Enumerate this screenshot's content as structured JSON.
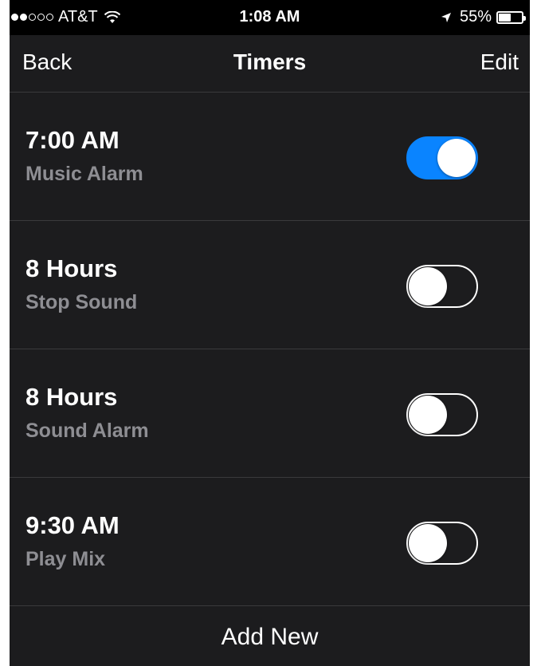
{
  "status_bar": {
    "carrier": "AT&T",
    "signal_bars_filled": 2,
    "signal_bars_total": 5,
    "time": "1:08 AM",
    "battery_percent": "55%",
    "battery_level": 0.55
  },
  "nav": {
    "back_label": "Back",
    "title": "Timers",
    "edit_label": "Edit"
  },
  "timers": [
    {
      "time": "7:00 AM",
      "label": "Music Alarm",
      "enabled": true
    },
    {
      "time": "8 Hours",
      "label": "Stop Sound",
      "enabled": false
    },
    {
      "time": "8 Hours",
      "label": "Sound Alarm",
      "enabled": false
    },
    {
      "time": "9:30 AM",
      "label": "Play Mix",
      "enabled": false
    }
  ],
  "add_new_label": "Add New",
  "colors": {
    "accent": "#0a84ff",
    "background": "#1c1c1e",
    "secondary_text": "#8e8e93"
  },
  "icons": [
    "wifi-icon",
    "location-arrow-icon",
    "battery-icon"
  ]
}
